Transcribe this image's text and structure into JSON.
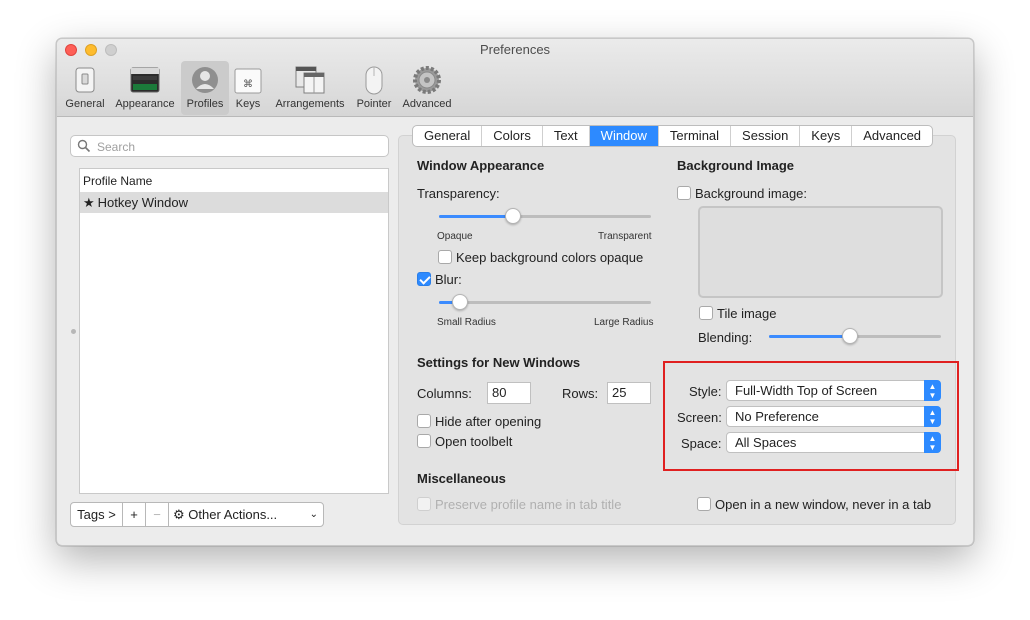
{
  "window": {
    "title": "Preferences"
  },
  "toolbar": {
    "items": [
      {
        "label": "General",
        "icon": "switch-icon"
      },
      {
        "label": "Appearance",
        "icon": "appearance-icon"
      },
      {
        "label": "Profiles",
        "icon": "profiles-icon",
        "active": true
      },
      {
        "label": "Keys",
        "icon": "keyboard-icon"
      },
      {
        "label": "Arrangements",
        "icon": "arrangements-icon"
      },
      {
        "label": "Pointer",
        "icon": "mouse-icon"
      },
      {
        "label": "Advanced",
        "icon": "gear-icon"
      }
    ]
  },
  "search": {
    "placeholder": "Search"
  },
  "profiles": {
    "column_header": "Profile Name",
    "rows": [
      {
        "name": "Hotkey Window",
        "default": true
      }
    ]
  },
  "bottom": {
    "tags_label": "Tags >",
    "add_label": "+",
    "remove_label": "−",
    "other_actions_label": "Other Actions..."
  },
  "tabs": [
    "General",
    "Colors",
    "Text",
    "Window",
    "Terminal",
    "Session",
    "Keys",
    "Advanced"
  ],
  "active_tab": "Window",
  "window_appearance": {
    "title": "Window Appearance",
    "transparency_label": "Transparency:",
    "transparency_value": 0.35,
    "opaque_label": "Opaque",
    "transparent_label": "Transparent",
    "keep_bg_label": "Keep background colors opaque",
    "keep_bg_checked": false,
    "blur_label": "Blur:",
    "blur_checked": true,
    "blur_value": 0.1,
    "small_radius_label": "Small Radius",
    "large_radius_label": "Large Radius"
  },
  "background_image": {
    "title": "Background Image",
    "checkbox_label": "Background image:",
    "checked": false,
    "tile_label": "Tile image",
    "tile_checked": false,
    "blending_label": "Blending:",
    "blending_value": 0.47
  },
  "new_windows": {
    "title": "Settings for New Windows",
    "columns_label": "Columns:",
    "columns_value": "80",
    "rows_label": "Rows:",
    "rows_value": "25",
    "hide_label": "Hide after opening",
    "hide_checked": false,
    "toolbelt_label": "Open toolbelt",
    "toolbelt_checked": false,
    "style_label": "Style:",
    "style_value": "Full-Width Top of Screen",
    "screen_label": "Screen:",
    "screen_value": "No Preference",
    "space_label": "Space:",
    "space_value": "All Spaces"
  },
  "misc": {
    "title": "Miscellaneous",
    "preserve_label": "Preserve profile name in tab title",
    "preserve_enabled": false,
    "new_window_label": "Open in a new window, never in a tab",
    "new_window_checked": false
  },
  "colors": {
    "accent": "#2d8aff",
    "highlight_box": "#e02020"
  }
}
